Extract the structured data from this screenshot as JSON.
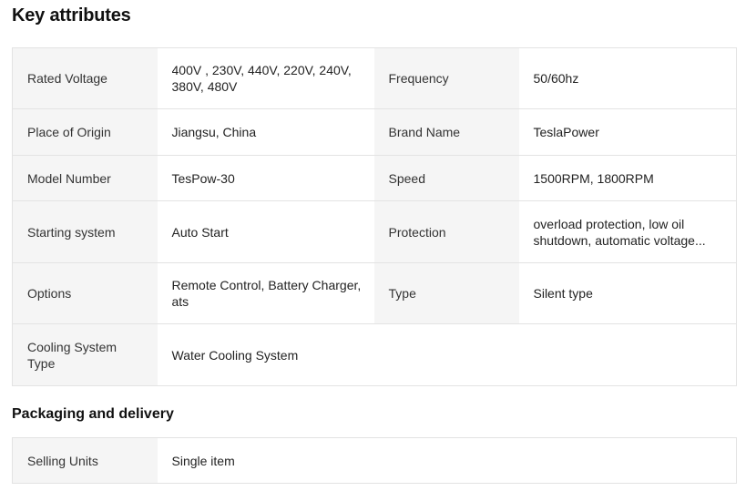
{
  "section1_title": "Key attributes",
  "attributes": [
    {
      "k1": "Rated Voltage",
      "v1": "400V , 230V, 440V, 220V, 240V, 380V, 480V",
      "k2": "Frequency",
      "v2": "50/60hz"
    },
    {
      "k1": "Place of Origin",
      "v1": "Jiangsu, China",
      "k2": "Brand Name",
      "v2": "TeslaPower"
    },
    {
      "k1": "Model Number",
      "v1": "TesPow-30",
      "k2": "Speed",
      "v2": "1500RPM, 1800RPM"
    },
    {
      "k1": "Starting system",
      "v1": "Auto Start",
      "k2": "Protection",
      "v2": "overload protection, low oil shutdown, automatic voltage..."
    },
    {
      "k1": "Options",
      "v1": "Remote Control, Battery Charger, ats",
      "k2": "Type",
      "v2": "Silent type"
    },
    {
      "k1": "Cooling System Type",
      "v1": "Water Cooling System"
    }
  ],
  "section2_title": "Packaging and delivery",
  "packaging": [
    {
      "k1": "Selling Units",
      "v1": "Single item"
    }
  ]
}
